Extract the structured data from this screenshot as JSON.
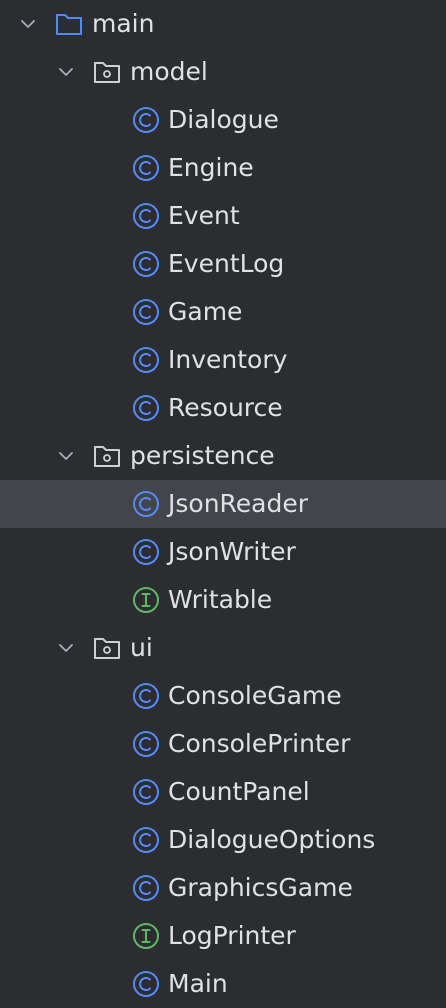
{
  "tree": {
    "root": {
      "label": "main",
      "icon": "folder-icon",
      "expanded": true
    },
    "packages": [
      {
        "label": "model",
        "icon": "package-icon",
        "expanded": true,
        "items": [
          {
            "label": "Dialogue",
            "kind": "class"
          },
          {
            "label": "Engine",
            "kind": "class"
          },
          {
            "label": "Event",
            "kind": "class"
          },
          {
            "label": "EventLog",
            "kind": "class"
          },
          {
            "label": "Game",
            "kind": "class"
          },
          {
            "label": "Inventory",
            "kind": "class"
          },
          {
            "label": "Resource",
            "kind": "class"
          }
        ]
      },
      {
        "label": "persistence",
        "icon": "package-icon",
        "expanded": true,
        "items": [
          {
            "label": "JsonReader",
            "kind": "class",
            "selected": true
          },
          {
            "label": "JsonWriter",
            "kind": "class"
          },
          {
            "label": "Writable",
            "kind": "interface"
          }
        ]
      },
      {
        "label": "ui",
        "icon": "package-icon",
        "expanded": true,
        "items": [
          {
            "label": "ConsoleGame",
            "kind": "class"
          },
          {
            "label": "ConsolePrinter",
            "kind": "class"
          },
          {
            "label": "CountPanel",
            "kind": "class"
          },
          {
            "label": "DialogueOptions",
            "kind": "class"
          },
          {
            "label": "GraphicsGame",
            "kind": "class"
          },
          {
            "label": "LogPrinter",
            "kind": "interface"
          },
          {
            "label": "Main",
            "kind": "class"
          }
        ]
      }
    ]
  },
  "colors": {
    "background": "#2b2d30",
    "selected_row": "#43454a",
    "text": "#dfe1e5",
    "chevron": "#a8adbd",
    "folder": "#548af7",
    "package": "#ced0d6",
    "class_icon": "#548af7",
    "interface_icon": "#5fb865"
  }
}
